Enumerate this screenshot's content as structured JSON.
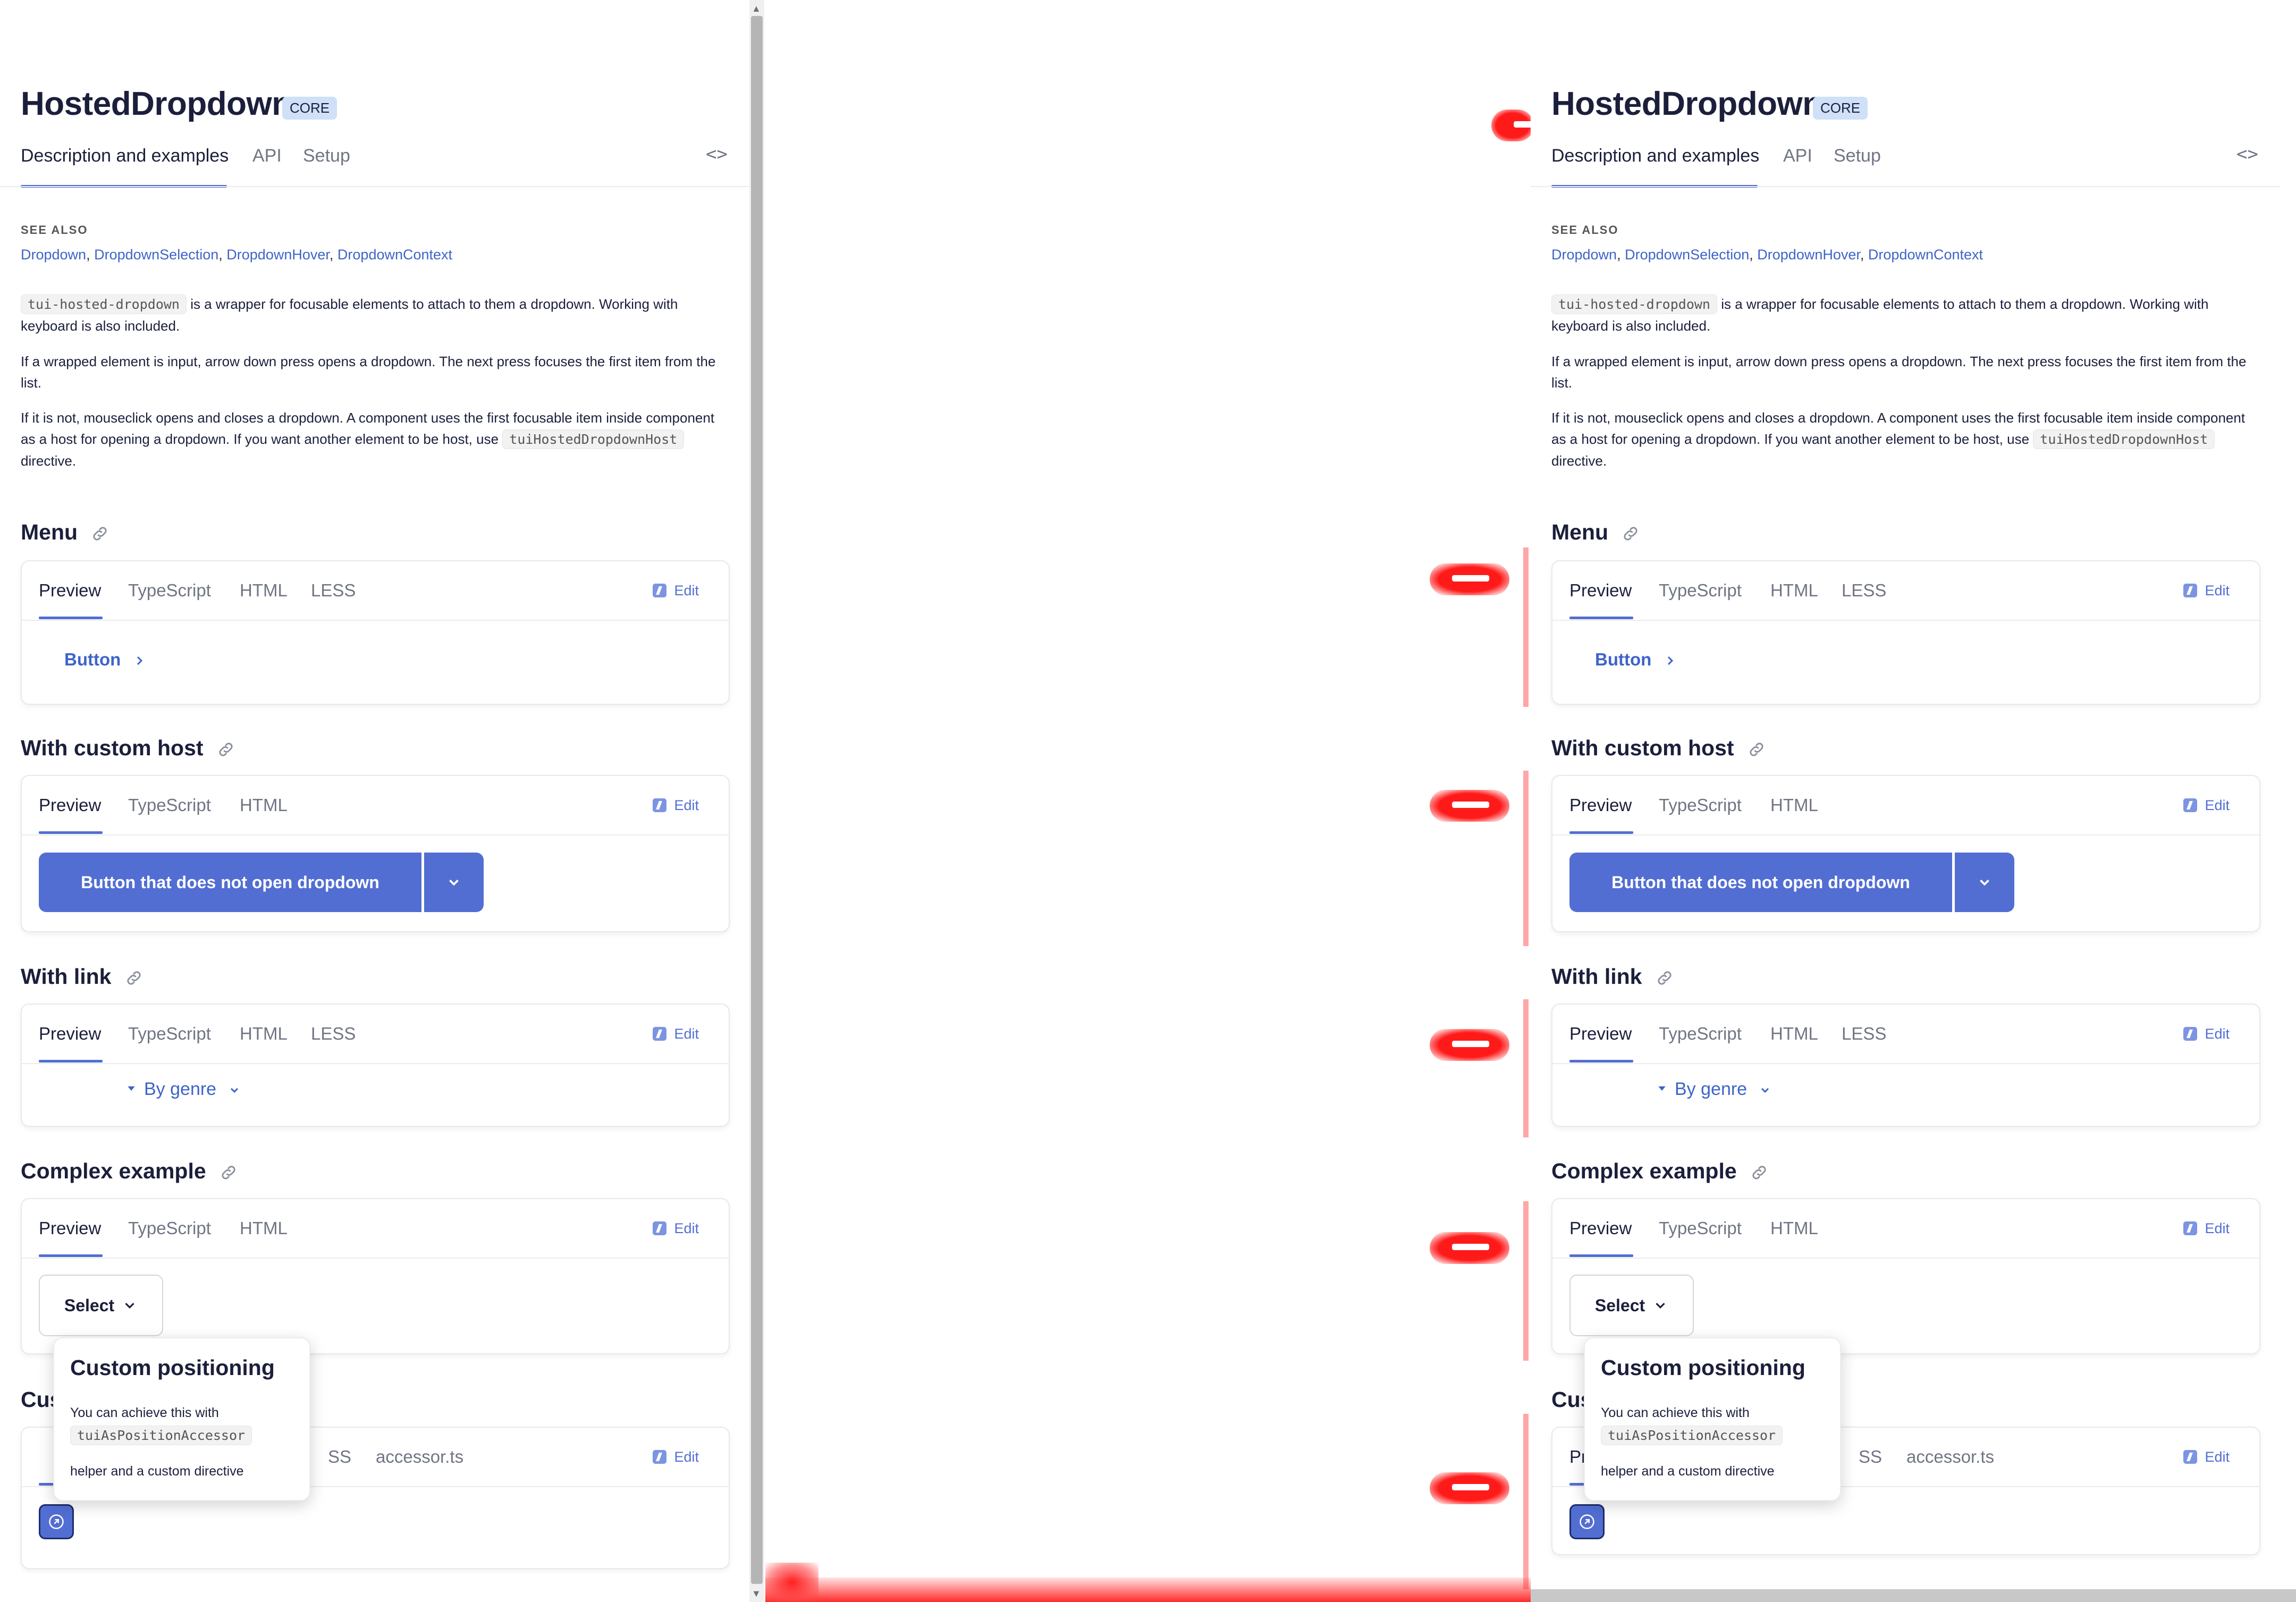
{
  "page": {
    "title": "HostedDropdown",
    "badge": "CORE",
    "tabs": [
      "Description and examples",
      "API",
      "Setup"
    ],
    "code_toggle": "<>"
  },
  "see_also": {
    "label": "SEE ALSO",
    "links": [
      "Dropdown",
      "DropdownSelection",
      "DropdownHover",
      "DropdownContext"
    ],
    "separator": ","
  },
  "description": {
    "p1_code": "tui-hosted-dropdown",
    "p1_text": "is a wrapper for focusable elements to attach to them a dropdown. Working with keyboard is also included.",
    "p2": "If a wrapped element is input, arrow down press opens a dropdown. The next press focuses the first item from the list.",
    "p3_text": "If it is not, mouseclick opens and closes a dropdown. A component uses the first focusable item inside component as a host for opening a dropdown. If you want another element to be host, use",
    "p3_code": "tuiHostedDropdownHost",
    "p3_end": "directive."
  },
  "example_tabs": {
    "preview": "Preview",
    "typescript": "TypeScript",
    "html": "HTML",
    "less": "LESS",
    "accessor": "accessor.ts",
    "edit": "Edit"
  },
  "examples": {
    "menu": {
      "title": "Menu",
      "button": "Button"
    },
    "custom_host": {
      "title": "With custom host",
      "button": "Button that does not open dropdown"
    },
    "with_link": {
      "title": "With link",
      "genre": "By genre"
    },
    "complex": {
      "title": "Complex example",
      "select": "Select"
    },
    "custom_positioning": {
      "title_visible": "Cust",
      "tab_visible": "Prev",
      "less_visible": "SS"
    }
  },
  "popover": {
    "title": "Custom positioning",
    "text1": "You can achieve this with",
    "code": "tuiAsPositionAccessor",
    "text2": "helper and a custom directive"
  },
  "colors": {
    "accent": "#526ed3",
    "link": "#3e64c9",
    "badge_bg": "#cfe0f7",
    "annotation_red": "#ff1a1a"
  }
}
